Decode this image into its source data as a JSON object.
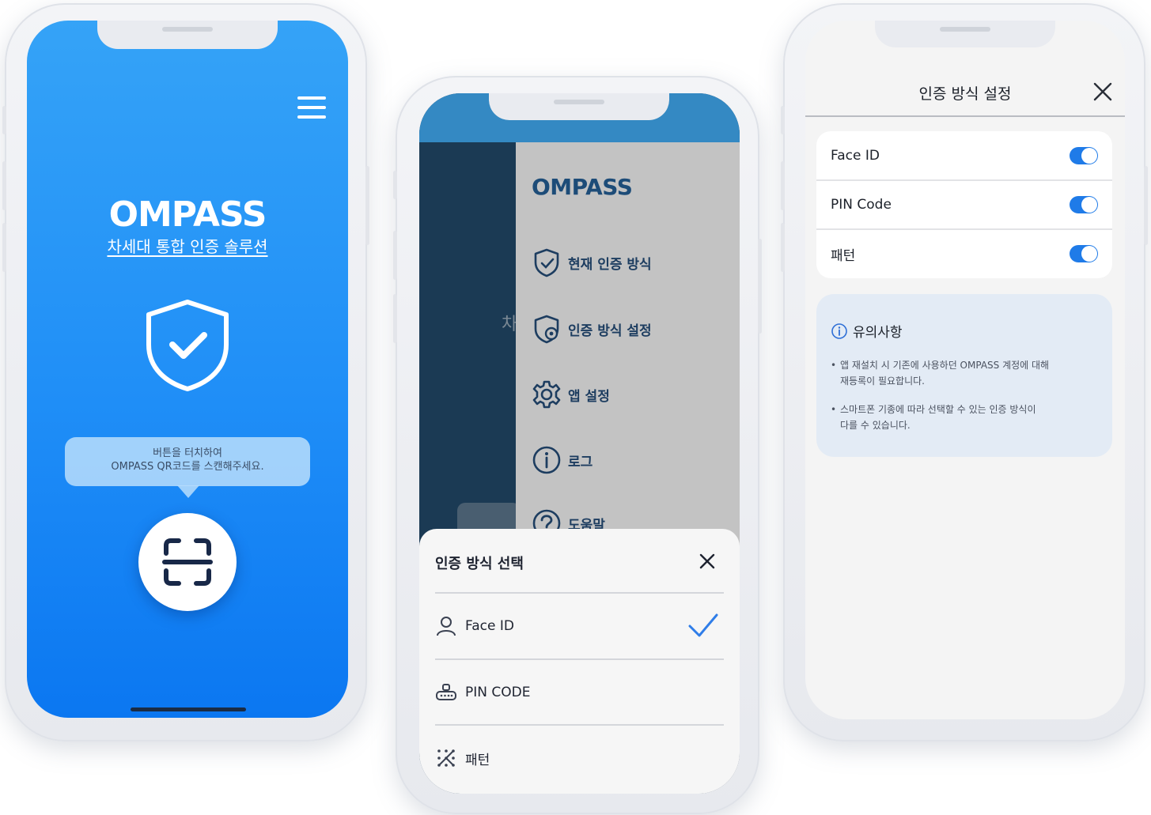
{
  "phone1": {
    "logo": "OMPASS",
    "tagline": "차세대 통합 인증 솔루션",
    "tooltip_line1": "버튼을 터치하여",
    "tooltip_line2": "OMPASS QR코드를 스캔해주세요."
  },
  "phone2": {
    "background_ghost_text": "차",
    "drawer": {
      "logo": "OMPASS",
      "items": [
        {
          "label": "현재 인증 방식",
          "icon": "shield-check-icon"
        },
        {
          "label": "인증 방식 설정",
          "icon": "shield-gear-icon"
        },
        {
          "label": "앱 설정",
          "icon": "gear-icon"
        },
        {
          "label": "로그",
          "icon": "info-icon"
        },
        {
          "label": "도움말",
          "icon": "help-icon"
        }
      ]
    },
    "sheet": {
      "title": "인증 방식 선택",
      "options": [
        {
          "label": "Face ID",
          "icon": "person-icon",
          "selected": true
        },
        {
          "label": "PIN CODE",
          "icon": "keypad-icon",
          "selected": false
        },
        {
          "label": "패턴",
          "icon": "pattern-icon",
          "selected": false
        }
      ]
    }
  },
  "phone3": {
    "title": "인증 방식 설정",
    "toggles": [
      {
        "label": "Face ID",
        "on": true
      },
      {
        "label": "PIN Code",
        "on": true
      },
      {
        "label": "패턴",
        "on": true
      }
    ],
    "notice": {
      "title": "유의사항",
      "bullets": [
        {
          "line1": "앱 재설치 시 기존에 사용하던 OMPASS 계정에 대해",
          "line2": "재등록이 필요합니다."
        },
        {
          "line1": "스마트폰 기종에 따라 선택할 수 있는 인증 방식이",
          "line2": "다를 수 있습니다."
        }
      ]
    }
  },
  "colors": {
    "primary_blue": "#1f8ef7",
    "navy": "#1d4c78",
    "toggle_on": "#1f7be8",
    "notice_bg": "#e3ebf5"
  }
}
